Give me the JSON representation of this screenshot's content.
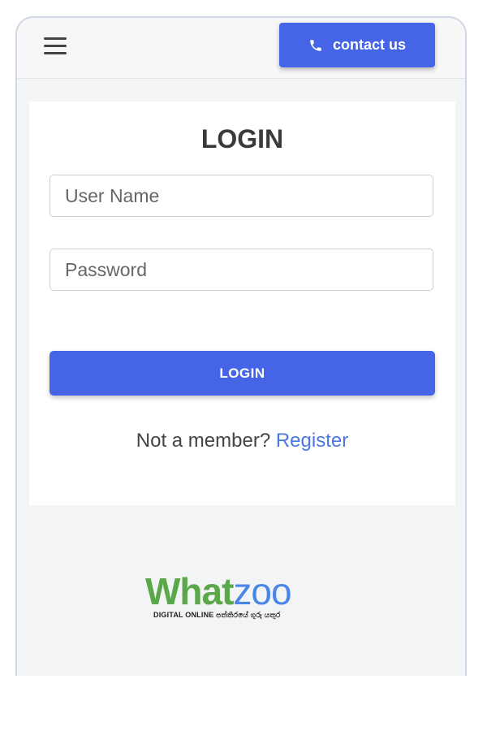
{
  "header": {
    "contact_label": "contact us"
  },
  "login": {
    "title": "LOGIN",
    "username_placeholder": "User Name",
    "password_placeholder": "Password",
    "button_label": "LOGIN",
    "not_member_text": "Not a member? ",
    "register_label": "Register"
  },
  "logo": {
    "part1": "What",
    "part2": "zoo",
    "tagline": "DIGITAL ONLINE පත්තිරයේ ගුරු යතුර"
  },
  "colors": {
    "primary": "#4565e6",
    "link": "#4a77e0",
    "logo_green": "#5aa84a",
    "logo_blue": "#4a86e8"
  },
  "icons": {
    "menu": "hamburger-menu-icon",
    "phone": "phone-icon"
  }
}
